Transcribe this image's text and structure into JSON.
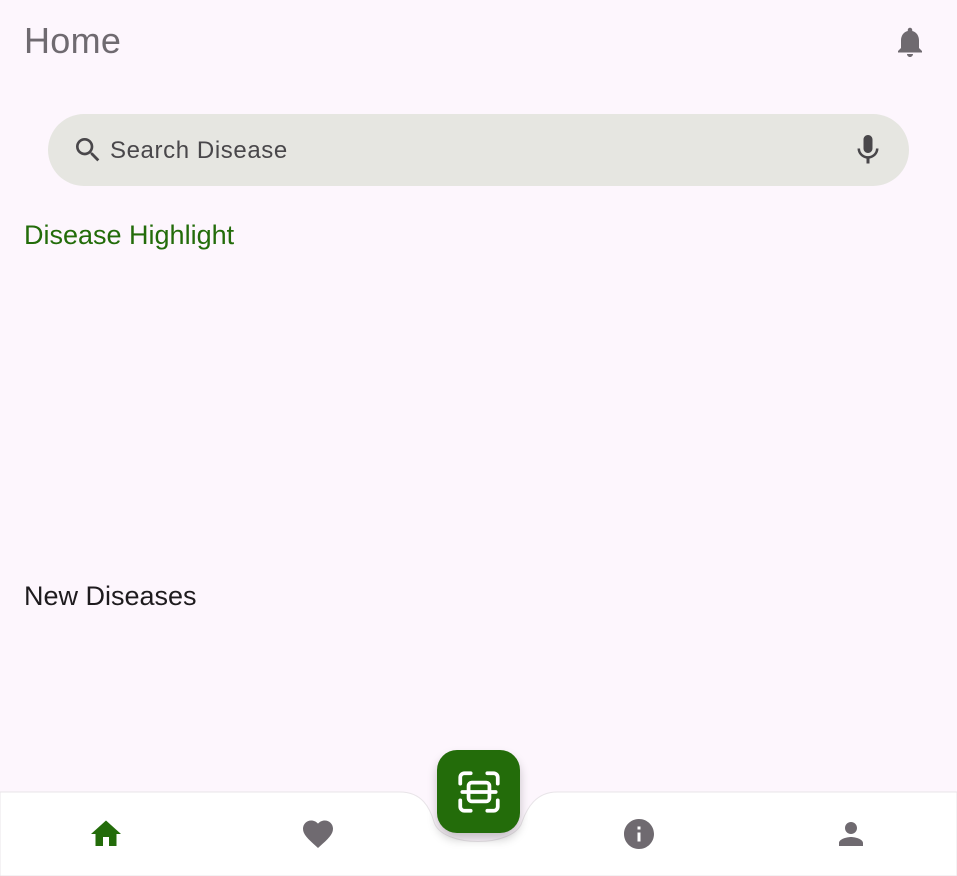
{
  "app_bar": {
    "title": "Home",
    "notification_icon": "bell-icon"
  },
  "search": {
    "placeholder": "Search Disease",
    "value": "",
    "leading_icon": "search-icon",
    "trailing_icon": "mic-icon"
  },
  "sections": {
    "highlight_title": "Disease Highlight",
    "new_title": "New Diseases"
  },
  "bottom_nav": {
    "items": [
      {
        "icon": "home-icon",
        "active": true
      },
      {
        "icon": "heart-icon",
        "active": false
      },
      {
        "icon": "info-icon",
        "active": false
      },
      {
        "icon": "person-icon",
        "active": false
      }
    ],
    "fab_icon": "scan-icon"
  },
  "colors": {
    "accent": "#236c0a",
    "background": "#fdf6fd",
    "search_bg": "#e6e6e1",
    "icon_inactive": "#6f6a70"
  }
}
